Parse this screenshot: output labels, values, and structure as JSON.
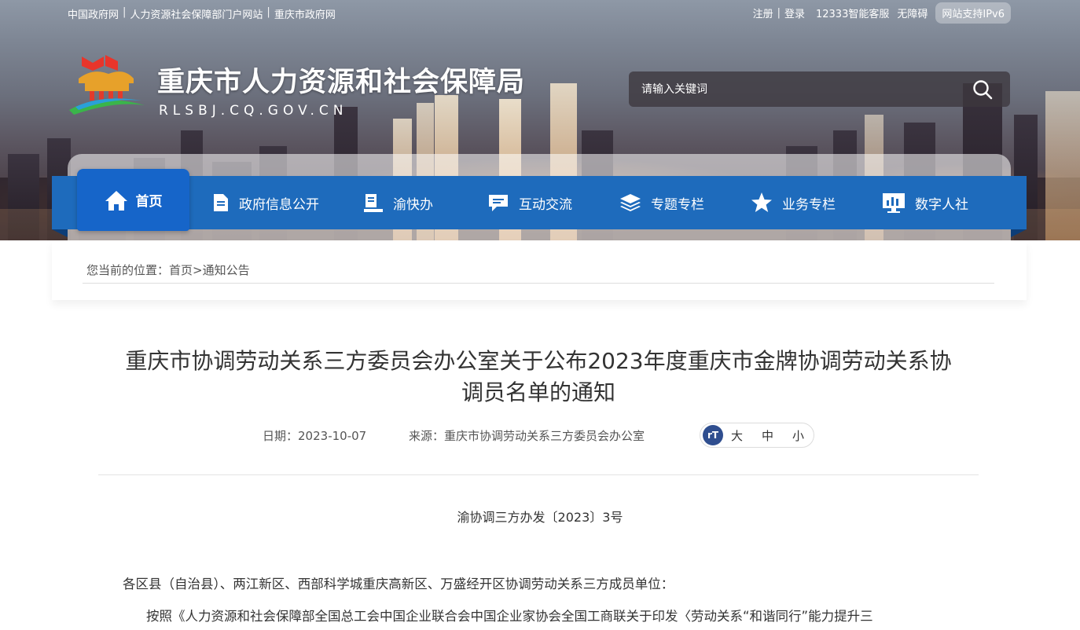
{
  "topbar": {
    "left_links": [
      "中国政府网",
      "人力资源社会保障部门户网站",
      "重庆市政府网"
    ],
    "register": "注册",
    "login": "登录",
    "hotline": "12333智能客服",
    "accessibility": "无障碍",
    "ipv6": "网站支持IPv6"
  },
  "header": {
    "site_title": "重庆市人力资源和社会保障局",
    "site_domain": "RLSBJ.CQ.GOV.CN",
    "search_placeholder": "请输入关键词"
  },
  "nav": {
    "items": [
      {
        "label": "首页",
        "icon": "home-icon"
      },
      {
        "label": "政府信息公开",
        "icon": "document-icon"
      },
      {
        "label": "渝快办",
        "icon": "service-icon"
      },
      {
        "label": "互动交流",
        "icon": "chat-icon"
      },
      {
        "label": "专题专栏",
        "icon": "layers-icon"
      },
      {
        "label": "业务专栏",
        "icon": "star-icon"
      },
      {
        "label": "数字人社",
        "icon": "monitor-icon"
      }
    ],
    "active": "首页"
  },
  "breadcrumb": {
    "prefix": "您当前的位置：",
    "home": "首页",
    "sep": ">",
    "current": "通知公告"
  },
  "article": {
    "title_line1": "重庆市协调劳动关系三方委员会办公室关于公布2023年度重庆市金牌协调劳动关系协",
    "title_line2": "调员名单的通知",
    "date_label": "日期：",
    "date": "2023-10-07",
    "source_label": "来源：",
    "source": "重庆市协调劳动关系三方委员会办公室",
    "font_icon": "rT",
    "font_sizes": [
      "大",
      "中",
      "小"
    ],
    "doc_number": "渝协调三方办发〔2023〕3号",
    "salutation": "各区县（自治县）、两江新区、西部科学城重庆高新区、万盛经开区协调劳动关系三方成员单位：",
    "body_start": "按照《人力资源和社会保障部全国总工会中国企业联合会中国企业家协会全国工商联关于印发〈劳动关系“和谐同行”能力提升三"
  },
  "colors": {
    "nav_bg": "#1e6bbc",
    "nav_active": "#1665c9",
    "text": "#333333"
  }
}
